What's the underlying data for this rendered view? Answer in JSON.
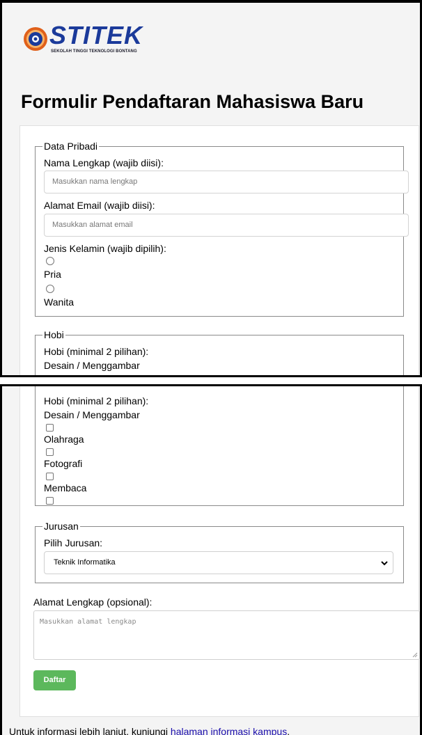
{
  "brand": {
    "name": "STITEK",
    "tagline": "SEKOLAH TINGGI TEKNOLOGI BONTANG",
    "primary_color": "#1b3a9a",
    "accent_color": "#e0601a"
  },
  "page_title": "Formulir Pendaftaran Mahasiswa Baru",
  "data_pribadi": {
    "legend": "Data Pribadi",
    "nama_label": "Nama Lengkap (wajib diisi):",
    "nama_placeholder": "Masukkan nama lengkap",
    "email_label": "Alamat Email (wajib diisi):",
    "email_placeholder": "Masukkan alamat email",
    "gender_label": "Jenis Kelamin (wajib dipilih):",
    "gender_options": [
      "Pria",
      "Wanita"
    ]
  },
  "hobi": {
    "legend": "Hobi",
    "label": "Hobi (minimal 2 pilihan):",
    "options": [
      "Desain / Menggambar",
      "Olahraga",
      "Fotografi",
      "Membaca"
    ]
  },
  "jurusan": {
    "legend": "Jurusan",
    "label": "Pilih Jurusan:",
    "selected": "Teknik Informatika"
  },
  "alamat": {
    "label": "Alamat Lengkap (opsional):",
    "placeholder": "Masukkan alamat lengkap"
  },
  "submit_label": "Daftar",
  "submit_color": "#5cb85c",
  "footer": {
    "text": "Untuk informasi lebih lanjut, kunjungi ",
    "link_text": "halaman informasi kampus",
    "suffix": "."
  }
}
